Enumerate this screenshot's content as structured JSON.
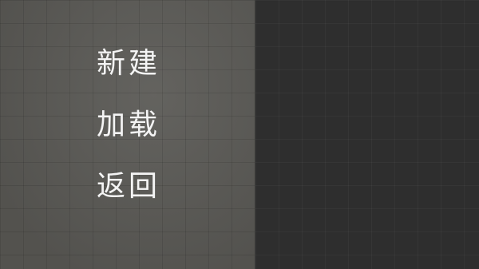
{
  "menu": {
    "items": [
      {
        "label": "新建"
      },
      {
        "label": "加载"
      },
      {
        "label": "返回"
      }
    ]
  },
  "colors": {
    "menu_panel_bg": "#5a5955",
    "preview_panel_bg": "#2e2e2e",
    "menu_text": "#f4f4f4"
  }
}
